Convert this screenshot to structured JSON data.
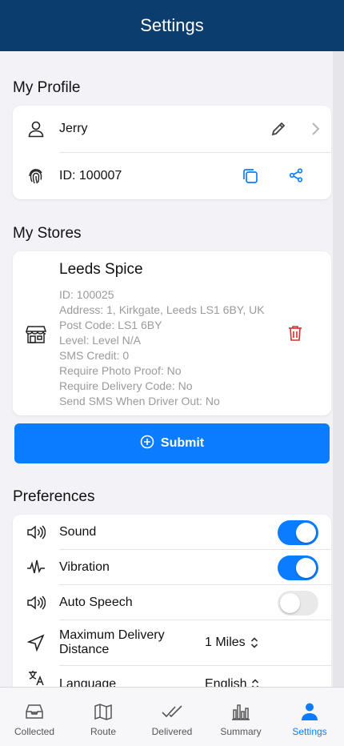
{
  "header": {
    "title": "Settings"
  },
  "profile": {
    "section_title": "My Profile",
    "name": "Jerry",
    "id_label": "ID: 100007"
  },
  "stores": {
    "section_title": "My Stores",
    "store": {
      "name": "Leeds Spice",
      "lines": [
        "ID: 100025",
        "Address: 1, Kirkgate, Leeds LS1 6BY, UK",
        "Post Code: LS1 6BY",
        "Level: Level N/A",
        "SMS Credit: 0",
        "Require Photo Proof: No",
        "Require Delivery Code: No",
        "Send SMS When Driver Out: No"
      ]
    },
    "submit_label": "Submit"
  },
  "preferences": {
    "section_title": "Preferences",
    "sound": {
      "label": "Sound",
      "on": true
    },
    "vibration": {
      "label": "Vibration",
      "on": true
    },
    "auto_speech": {
      "label": "Auto Speech",
      "on": false
    },
    "max_distance": {
      "label": "Maximum Delivery Distance",
      "value": "1 Miles"
    },
    "language": {
      "label": "Language",
      "value": "English"
    }
  },
  "tabs": [
    {
      "label": "Collected",
      "icon": "tray-icon",
      "active": false
    },
    {
      "label": "Route",
      "icon": "map-icon",
      "active": false
    },
    {
      "label": "Delivered",
      "icon": "double-check-icon",
      "active": false
    },
    {
      "label": "Summary",
      "icon": "bar-chart-icon",
      "active": false
    },
    {
      "label": "Settings",
      "icon": "person-icon",
      "active": true
    }
  ],
  "colors": {
    "header": "#0b3d6e",
    "accent": "#0a7cff",
    "danger": "#d0312d"
  }
}
